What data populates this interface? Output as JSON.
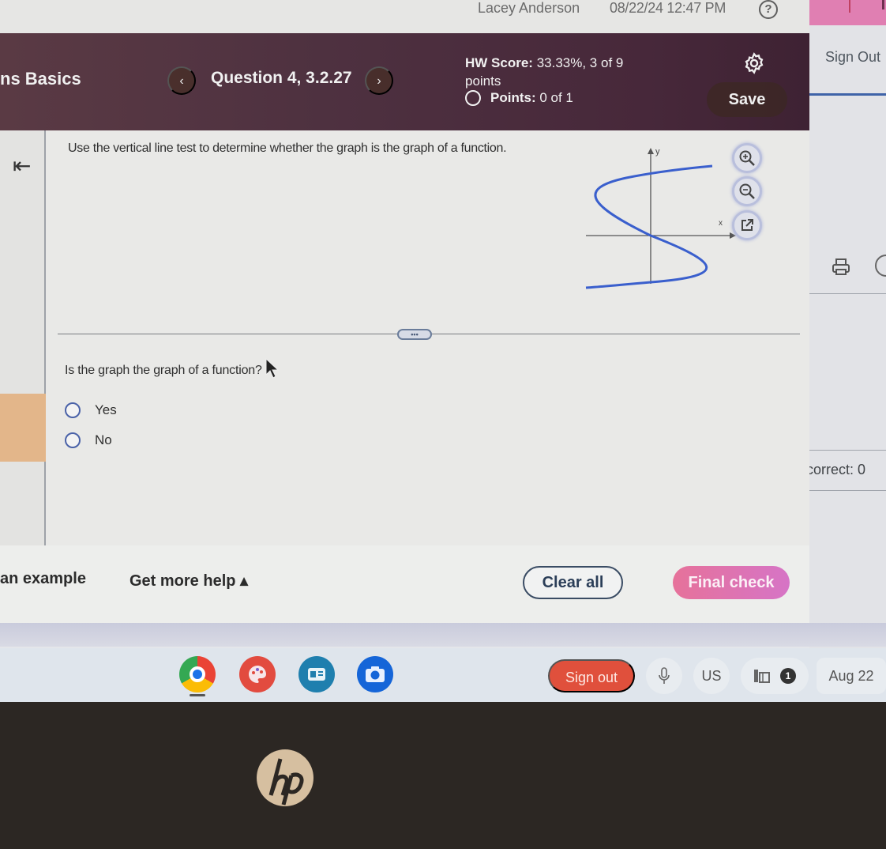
{
  "topbar": {
    "user_name": "Lacey Anderson",
    "datetime": "08/22/24 12:47 PM",
    "help_icon": "?"
  },
  "header": {
    "course_title": "ns Basics",
    "prev_icon": "‹",
    "question_title": "Question 4, 3.2.27",
    "next_icon": "›",
    "hw_score_label": "HW Score:",
    "hw_score_value": "33.33%, 3 of 9 points",
    "points_label": "Points:",
    "points_value": "0 of 1",
    "save_label": "Save"
  },
  "right_pane": {
    "sign_out_label": "Sign Out",
    "correct_label": "correct: 0"
  },
  "question": {
    "instruction": "Use the vertical line test to determine whether the graph is the graph of a function.",
    "graph": {
      "x_axis_label": "x",
      "y_axis_label": "y",
      "curve_color": "#3a5fcd",
      "curve_shape": "S-shaped curve (cubic in y) crossing origin"
    },
    "more_label": "•••",
    "prompt": "Is the graph the graph of a function?",
    "options": [
      {
        "label": "Yes",
        "selected": false
      },
      {
        "label": "No",
        "selected": false
      }
    ]
  },
  "toolbar": {
    "example_label": "an example",
    "help_label": "Get more help ▴",
    "clear_label": "Clear all",
    "final_check_label": "Final check"
  },
  "shelf": {
    "apps": [
      "Chrome",
      "Canvas",
      "Files",
      "Camera"
    ],
    "sign_out_label": "Sign out",
    "keyboard_layout": "US",
    "notification_count": "1",
    "date": "Aug 22"
  },
  "colors": {
    "header_bg": "#4e3140",
    "final_check": "#e072b0",
    "sign_out": "#e0503c",
    "accent_blue": "#3f63a8"
  }
}
